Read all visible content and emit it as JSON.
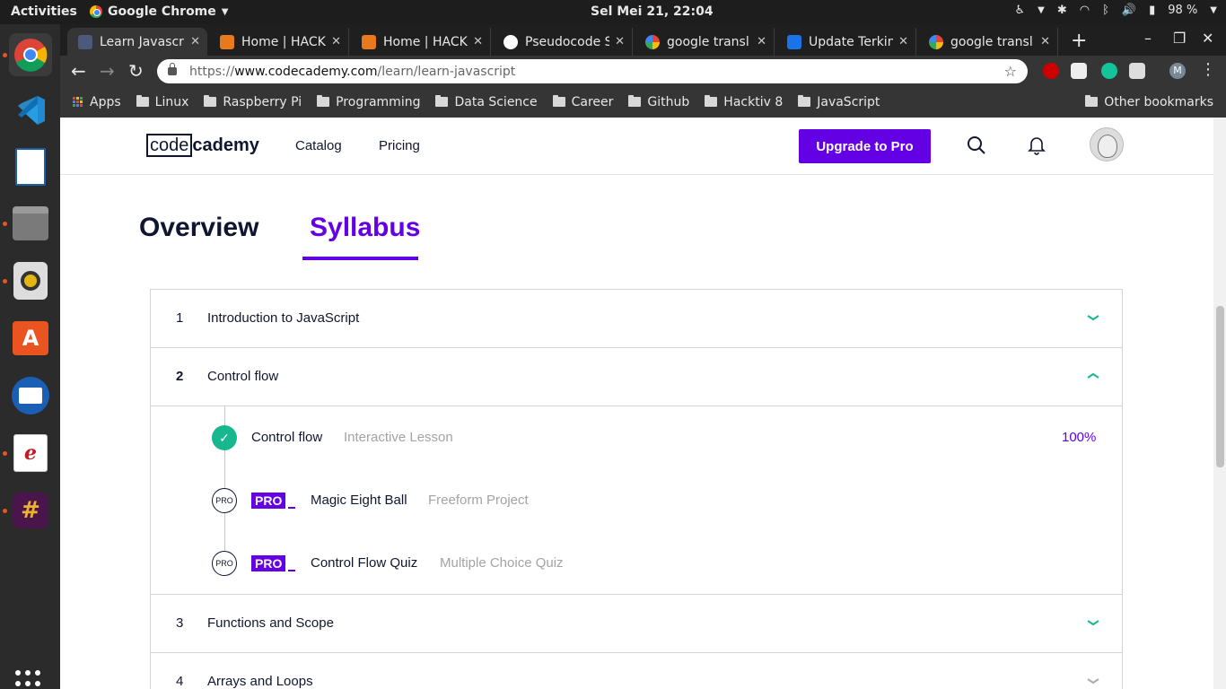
{
  "topbar": {
    "activities": "Activities",
    "app_name": "Google Chrome",
    "clock": "Sel Mei 21, 22:04",
    "battery": "98 %"
  },
  "tabs": [
    {
      "title": "Learn Javascri",
      "favicon_color": "#4b5a7a",
      "active": true
    },
    {
      "title": "Home | HACK",
      "favicon_color": "#e8791c"
    },
    {
      "title": "Home | HACK",
      "favicon_color": "#e8791c"
    },
    {
      "title": "Pseudocode S",
      "favicon_color": "#ffffff"
    },
    {
      "title": "google transl",
      "favicon_color": "#4285f4"
    },
    {
      "title": "Update Terkin",
      "favicon_color": "#1a73e8"
    },
    {
      "title": "google transl",
      "favicon_color": "#4285f4"
    }
  ],
  "browser": {
    "url_scheme": "https://",
    "url_host": "www.codecademy.com",
    "url_path": "/learn/learn-javascript",
    "profile_initial": "M"
  },
  "bookmarks": {
    "apps": "Apps",
    "folders": [
      "Linux",
      "Raspberry Pi",
      "Programming",
      "Data Science",
      "Career",
      "Github",
      "Hacktiv 8",
      "JavaScript"
    ],
    "other": "Other bookmarks"
  },
  "site": {
    "logo_boxed": "code",
    "logo_rest": "cademy",
    "nav": [
      "Catalog",
      "Pricing"
    ],
    "upgrade_label": "Upgrade to Pro"
  },
  "page_tabs": {
    "overview": "Overview",
    "syllabus": "Syllabus"
  },
  "modules": [
    {
      "num": "1",
      "name": "Introduction to JavaScript",
      "expanded": false
    },
    {
      "num": "2",
      "name": "Control flow",
      "expanded": true
    },
    {
      "num": "3",
      "name": "Functions and Scope",
      "expanded": false
    },
    {
      "num": "4",
      "name": "Arrays and Loops",
      "expanded": false
    }
  ],
  "lessons": [
    {
      "name": "Control flow",
      "type": "Interactive Lesson",
      "progress": "100%",
      "completed": true,
      "pro": false
    },
    {
      "name": "Magic Eight Ball",
      "type": "Freeform Project",
      "pro": true,
      "pro_circle": "PRO",
      "pro_tag": "PRO"
    },
    {
      "name": "Control Flow Quiz",
      "type": "Multiple Choice Quiz",
      "pro": true,
      "pro_circle": "PRO",
      "pro_tag": "PRO"
    }
  ],
  "colors": {
    "accent_purple": "#6400e4",
    "complete_green": "#17b890",
    "chevron_teal": "#17b890"
  }
}
